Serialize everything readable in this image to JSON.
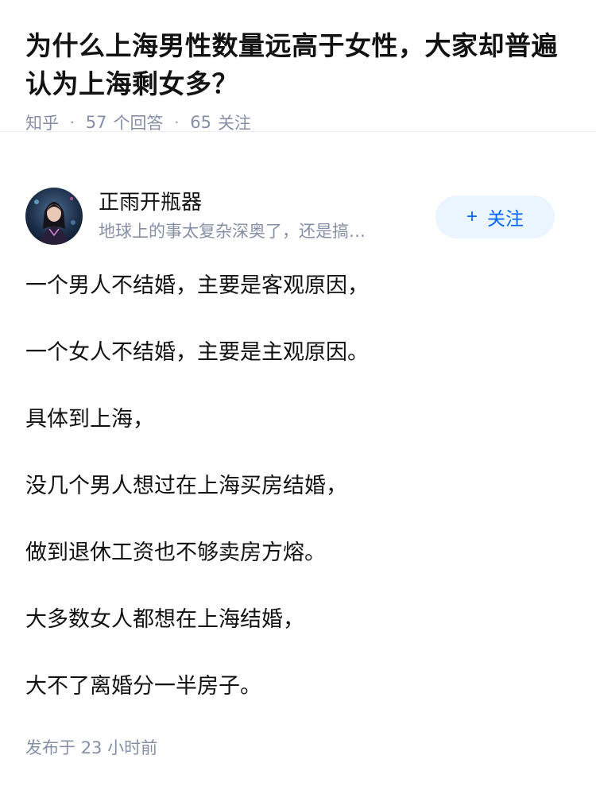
{
  "question": {
    "title": "为什么上海男性数量远高于女性，大家却普遍认为上海剩女多？",
    "source": "知乎",
    "answer_count": "57",
    "answer_label": "个回答",
    "follow_count": "65",
    "follow_label": "关注"
  },
  "author": {
    "name": "正雨开瓶器",
    "bio": "地球上的事太复杂深奥了，还是搞…",
    "follow_button_label": "关注",
    "follow_button_icon": "plus-icon"
  },
  "answer": {
    "paragraphs": [
      "一个男人不结婚，主要是客观原因，",
      "一个女人不结婚，主要是主观原因。",
      "具体到上海，",
      "没几个男人想过在上海买房结婚，",
      "做到退休工资也不够卖房方熔。",
      "大多数女人都想在上海结婚，",
      "大不了离婚分一半房子。"
    ],
    "published_label": "发布于",
    "published_time": "23 小时前"
  },
  "colors": {
    "text_primary": "#121212",
    "text_secondary": "#8590a6",
    "accent": "#0066ff",
    "button_bg": "#ebf5ff"
  }
}
